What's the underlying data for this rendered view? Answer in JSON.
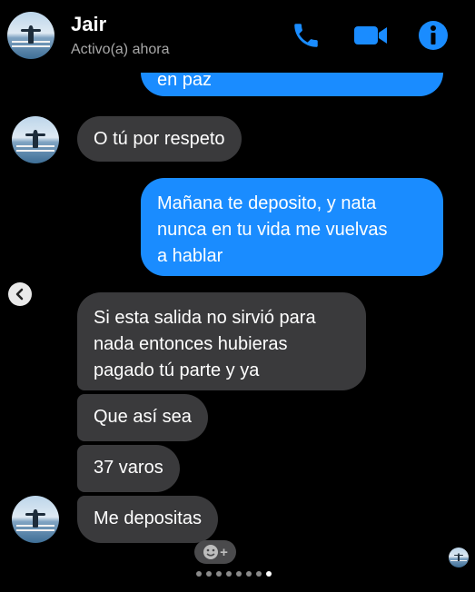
{
  "header": {
    "name": "Jair",
    "status": "Activo(a) ahora",
    "icons": [
      "phone-icon",
      "video-camera-icon",
      "info-icon"
    ],
    "accent": "#1a8cff"
  },
  "messages": [
    {
      "from": "me",
      "text": "en paz"
    },
    {
      "from": "them",
      "text": "O tú por respeto"
    },
    {
      "from": "me",
      "text": "Mañana te deposito, y nata\nnunca en tu vida me vuelvas\na hablar"
    },
    {
      "from": "them",
      "text": "Si esta salida no sirvió para\nnada entonces hubieras\npagado tú parte y ya"
    },
    {
      "from": "them",
      "text": "Que así sea"
    },
    {
      "from": "them",
      "text": "37 varos"
    },
    {
      "from": "them",
      "text": "Me depositas"
    }
  ],
  "react_button": {
    "label": "+"
  },
  "carousel": {
    "count": 8,
    "active": 8
  },
  "colors": {
    "incoming_bubble": "#3a3a3c",
    "outgoing_bubble": "#1a8cff",
    "background": "#000000"
  }
}
